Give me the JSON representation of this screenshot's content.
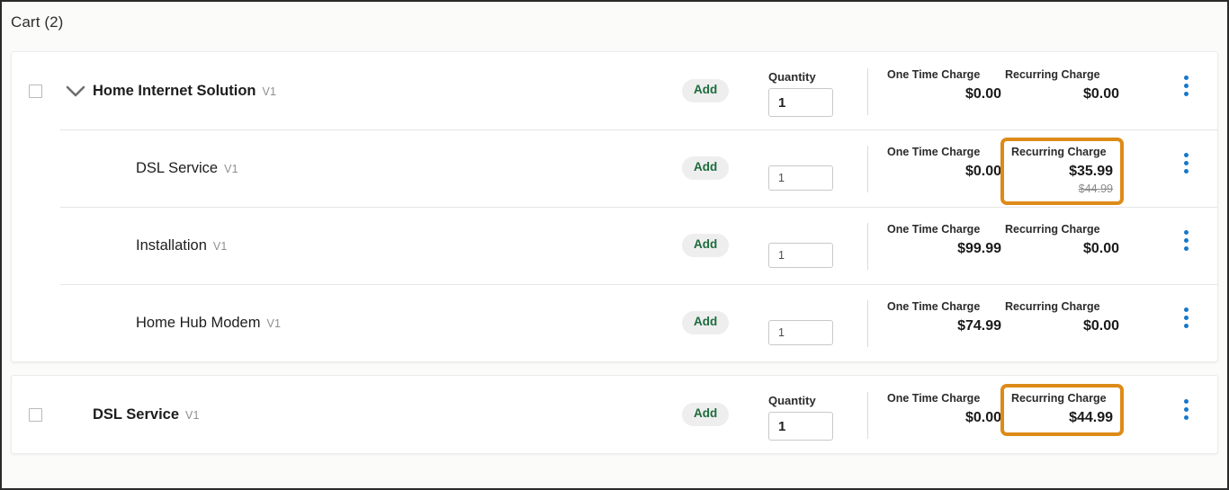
{
  "header": {
    "title": "Cart (2)"
  },
  "labels": {
    "quantity": "Quantity",
    "one_time_charge": "One Time Charge",
    "recurring_charge": "Recurring Charge",
    "add": "Add"
  },
  "colors": {
    "highlight_border": "#dd8b18",
    "add_text": "#1c6b3c",
    "kebab_dot": "#1678c8",
    "page_background": "#fbfbfa",
    "card_background": "#ffffff"
  },
  "cards": [
    {
      "rows": [
        {
          "level": "parent",
          "has_checkbox": true,
          "has_chevron": true,
          "name": "Home Internet Solution",
          "version": "V1",
          "add_label": "Add",
          "quantity_label": "Quantity",
          "quantity": "1",
          "one_time_label": "One Time Charge",
          "one_time_value": "$0.00",
          "recurring_label": "Recurring Charge",
          "recurring_value": "$0.00",
          "recurring_old_value": "",
          "recurring_highlighted": false
        },
        {
          "level": "child",
          "has_checkbox": false,
          "has_chevron": false,
          "name": "DSL Service",
          "version": "V1",
          "add_label": "Add",
          "quantity_label": "",
          "quantity": "1",
          "one_time_label": "One Time Charge",
          "one_time_value": "$0.00",
          "recurring_label": "Recurring Charge",
          "recurring_value": "$35.99",
          "recurring_old_value": "$44.99",
          "recurring_highlighted": true
        },
        {
          "level": "child",
          "has_checkbox": false,
          "has_chevron": false,
          "name": "Installation",
          "version": "V1",
          "add_label": "Add",
          "quantity_label": "",
          "quantity": "1",
          "one_time_label": "One Time Charge",
          "one_time_value": "$99.99",
          "recurring_label": "Recurring Charge",
          "recurring_value": "$0.00",
          "recurring_old_value": "",
          "recurring_highlighted": false
        },
        {
          "level": "child",
          "has_checkbox": false,
          "has_chevron": false,
          "name": "Home Hub Modem",
          "version": "V1",
          "add_label": "Add",
          "quantity_label": "",
          "quantity": "1",
          "one_time_label": "One Time Charge",
          "one_time_value": "$74.99",
          "recurring_label": "Recurring Charge",
          "recurring_value": "$0.00",
          "recurring_old_value": "",
          "recurring_highlighted": false
        }
      ]
    },
    {
      "rows": [
        {
          "level": "parent",
          "has_checkbox": true,
          "has_chevron": false,
          "name": "DSL Service",
          "version": "V1",
          "add_label": "Add",
          "quantity_label": "Quantity",
          "quantity": "1",
          "one_time_label": "One Time Charge",
          "one_time_value": "$0.00",
          "recurring_label": "Recurring Charge",
          "recurring_value": "$44.99",
          "recurring_old_value": "",
          "recurring_highlighted": true
        }
      ]
    }
  ]
}
